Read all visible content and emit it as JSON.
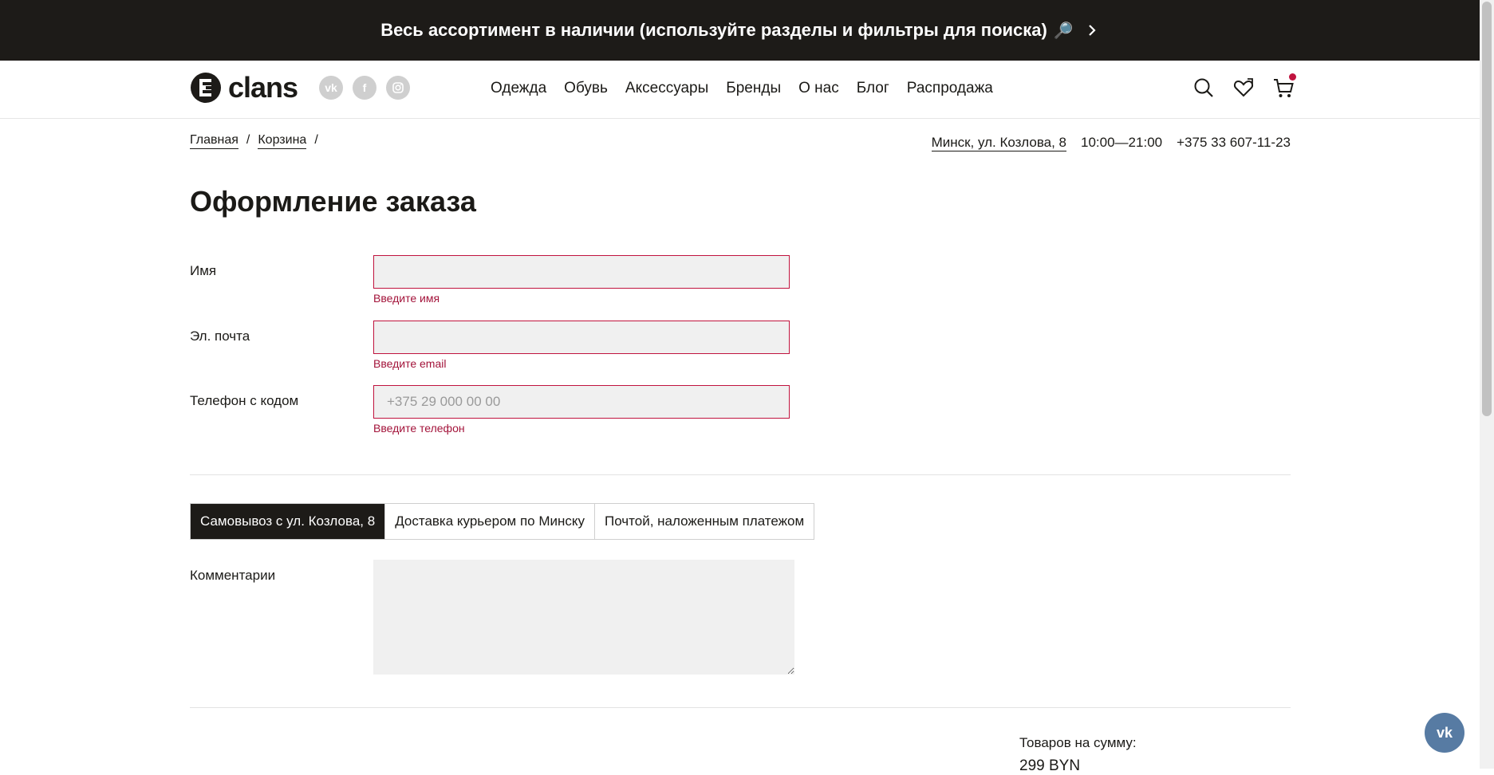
{
  "promo": {
    "text": "Весь ассортимент в наличии (используйте разделы и фильтры для поиска)",
    "emoji": "🔎"
  },
  "header": {
    "logo_text": "clans",
    "socials": [
      "vk-icon",
      "facebook-icon",
      "instagram-icon"
    ],
    "nav": [
      "Одежда",
      "Обувь",
      "Аксессуары",
      "Бренды",
      "О нас",
      "Блог",
      "Распродажа"
    ]
  },
  "breadcrumb": {
    "items": [
      "Главная",
      "Корзина"
    ],
    "separator": "/"
  },
  "contacts": {
    "address": "Минск, ул. Козлова, 8",
    "hours": "10:00—21:00",
    "phone": "+375 33 607-11-23"
  },
  "page_title": "Оформление заказа",
  "form": {
    "name": {
      "label": "Имя",
      "value": "",
      "error": "Введите имя"
    },
    "email": {
      "label": "Эл. почта",
      "value": "",
      "error": "Введите email"
    },
    "phone": {
      "label": "Телефон с кодом",
      "placeholder": "+375 29 000 00 00",
      "error": "Введите телефон"
    }
  },
  "delivery_tabs": [
    {
      "label": "Самовывоз с ул. Козлова, 8",
      "active": true
    },
    {
      "label": "Доставка курьером по Минску",
      "active": false
    },
    {
      "label": "Почтой, наложенным платежом",
      "active": false
    }
  ],
  "comment": {
    "label": "Комментарии"
  },
  "summary": {
    "label": "Товаров на сумму:",
    "value": "299 BYN"
  },
  "colors": {
    "accent": "#c0133e",
    "dark": "#1d1b18",
    "vk": "#577ba3"
  }
}
